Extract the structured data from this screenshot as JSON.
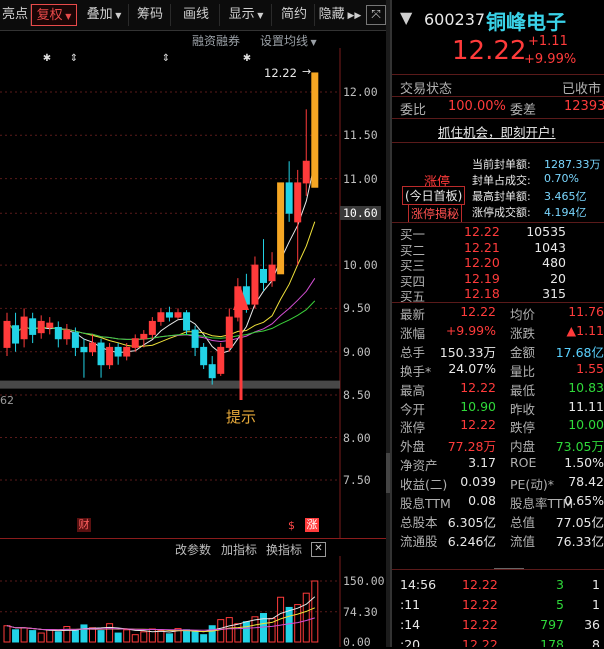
{
  "toolbar": {
    "items": [
      "亮点",
      "复权",
      "叠加",
      "筹码",
      "画线",
      "显示",
      "简约",
      "隐藏"
    ],
    "active_index": 1,
    "close_icon": "resize-icon"
  },
  "subheader": {
    "margin_label": "融资融券",
    "ma_label": "设置均线"
  },
  "main_chart": {
    "price_label": "12.22",
    "y_ticks": [
      "12.00",
      "11.50",
      "11.00",
      "10.60",
      "10.00",
      "9.50",
      "9.00",
      "8.50",
      "8.00",
      "7.50"
    ],
    "highlight_tick": "10.60",
    "low_label": "62",
    "annotation": "提示",
    "badge_fin": "财",
    "badge_zhang": "涨"
  },
  "volume_panel": {
    "buttons": [
      "改参数",
      "加指标",
      "换指标"
    ],
    "y_ticks": [
      "150.00",
      "74.30",
      "0.00"
    ]
  },
  "chart_data": {
    "type": "candlestick",
    "y_axis_ticks": [
      12.0,
      11.5,
      11.0,
      10.6,
      10.0,
      9.5,
      9.0,
      8.5
    ],
    "last_price_label": 12.22,
    "candles": [
      {
        "o": 9.05,
        "c": 9.35,
        "h": 9.45,
        "l": 8.95,
        "up": true
      },
      {
        "o": 9.3,
        "c": 9.1,
        "h": 9.45,
        "l": 9.0,
        "up": false
      },
      {
        "o": 9.15,
        "c": 9.4,
        "h": 9.5,
        "l": 9.05,
        "up": true
      },
      {
        "o": 9.38,
        "c": 9.2,
        "h": 9.45,
        "l": 9.1,
        "up": false
      },
      {
        "o": 9.22,
        "c": 9.35,
        "h": 9.42,
        "l": 9.15,
        "up": true
      },
      {
        "o": 9.33,
        "c": 9.28,
        "h": 9.4,
        "l": 9.2,
        "up": true
      },
      {
        "o": 9.28,
        "c": 9.15,
        "h": 9.35,
        "l": 9.05,
        "up": false
      },
      {
        "o": 9.15,
        "c": 9.25,
        "h": 9.32,
        "l": 9.08,
        "up": true
      },
      {
        "o": 9.22,
        "c": 9.05,
        "h": 9.28,
        "l": 8.95,
        "up": false
      },
      {
        "o": 9.05,
        "c": 9.0,
        "h": 9.15,
        "l": 8.7,
        "up": false
      },
      {
        "o": 9.0,
        "c": 9.1,
        "h": 9.2,
        "l": 8.95,
        "up": true
      },
      {
        "o": 9.1,
        "c": 8.85,
        "h": 9.15,
        "l": 8.7,
        "up": false
      },
      {
        "o": 8.85,
        "c": 9.05,
        "h": 9.1,
        "l": 8.8,
        "up": true
      },
      {
        "o": 9.05,
        "c": 8.95,
        "h": 9.1,
        "l": 8.85,
        "up": false
      },
      {
        "o": 8.95,
        "c": 9.05,
        "h": 9.1,
        "l": 8.9,
        "up": true
      },
      {
        "o": 9.05,
        "c": 9.15,
        "h": 9.2,
        "l": 9.0,
        "up": true
      },
      {
        "o": 9.15,
        "c": 9.2,
        "h": 9.25,
        "l": 9.05,
        "up": true
      },
      {
        "o": 9.2,
        "c": 9.35,
        "h": 9.4,
        "l": 9.15,
        "up": true
      },
      {
        "o": 9.35,
        "c": 9.45,
        "h": 9.5,
        "l": 9.3,
        "up": true
      },
      {
        "o": 9.45,
        "c": 9.4,
        "h": 9.52,
        "l": 9.35,
        "up": false
      },
      {
        "o": 9.4,
        "c": 9.45,
        "h": 9.5,
        "l": 9.38,
        "up": true
      },
      {
        "o": 9.45,
        "c": 9.25,
        "h": 9.48,
        "l": 9.2,
        "up": false
      },
      {
        "o": 9.25,
        "c": 9.05,
        "h": 9.3,
        "l": 8.95,
        "up": false
      },
      {
        "o": 9.05,
        "c": 8.85,
        "h": 9.1,
        "l": 8.8,
        "up": false
      },
      {
        "o": 8.85,
        "c": 8.7,
        "h": 8.95,
        "l": 8.62,
        "up": false
      },
      {
        "o": 8.75,
        "c": 9.05,
        "h": 9.1,
        "l": 8.72,
        "up": true
      },
      {
        "o": 9.05,
        "c": 9.4,
        "h": 9.5,
        "l": 9.0,
        "up": true
      },
      {
        "o": 9.4,
        "c": 9.75,
        "h": 9.85,
        "l": 9.35,
        "up": true
      },
      {
        "o": 9.75,
        "c": 9.55,
        "h": 9.9,
        "l": 9.45,
        "up": false
      },
      {
        "o": 9.55,
        "c": 10.0,
        "h": 10.1,
        "l": 9.5,
        "up": true
      },
      {
        "o": 9.95,
        "c": 9.8,
        "h": 10.3,
        "l": 9.7,
        "up": false
      },
      {
        "o": 9.82,
        "c": 10.0,
        "h": 10.15,
        "l": 9.75,
        "up": true
      },
      {
        "o": 9.9,
        "c": 10.95,
        "h": 10.95,
        "l": 9.9,
        "up": true,
        "limit": true
      },
      {
        "o": 10.95,
        "c": 10.6,
        "h": 11.2,
        "l": 10.5,
        "up": false
      },
      {
        "o": 10.5,
        "c": 10.95,
        "h": 11.1,
        "l": 10.0,
        "up": true
      },
      {
        "o": 10.95,
        "c": 11.2,
        "h": 11.8,
        "l": 10.8,
        "up": true
      },
      {
        "o": 10.9,
        "c": 12.22,
        "h": 12.22,
        "l": 10.9,
        "up": true,
        "limit": true
      }
    ],
    "volume": [
      40,
      30,
      35,
      28,
      22,
      30,
      25,
      38,
      30,
      42,
      35,
      28,
      45,
      22,
      30,
      18,
      25,
      32,
      28,
      20,
      33,
      30,
      25,
      18,
      40,
      55,
      60,
      45,
      50,
      62,
      70,
      58,
      110,
      85,
      92,
      120,
      150
    ],
    "volume_ylim": [
      0,
      150
    ]
  },
  "quote": {
    "code": "600237",
    "name": "铜峰电子",
    "price": "12.22",
    "change": "+1.11",
    "change_pct": "+9.99%",
    "trade_status_label": "交易状态",
    "trade_status": "已收市",
    "wb_label": "委比",
    "wb_value": "100.00%",
    "wc_label": "委差",
    "wc_value": "12393",
    "promo": "抓住机会，即刻开户!",
    "limit_tag": "涨停",
    "limit_sub": "(今日首板)",
    "limit_btn": "涨停揭秘",
    "seal": [
      {
        "k": "当前封单额:",
        "v": "1287.33万"
      },
      {
        "k": "封单占成交:",
        "v": "0.70%"
      },
      {
        "k": "最高封单额:",
        "v": "3.465亿"
      },
      {
        "k": "涨停成交额:",
        "v": "4.194亿"
      }
    ],
    "bids": [
      {
        "k": "买一",
        "p": "12.22",
        "v": "10535"
      },
      {
        "k": "买二",
        "p": "12.21",
        "v": "1043"
      },
      {
        "k": "买三",
        "p": "12.20",
        "v": "480"
      },
      {
        "k": "买四",
        "p": "12.19",
        "v": "20"
      },
      {
        "k": "买五",
        "p": "12.18",
        "v": "315"
      }
    ],
    "stats": [
      {
        "k1": "最新",
        "v1": "12.22",
        "c1": "red",
        "k2": "均价",
        "v2": "11.76",
        "c2": "red"
      },
      {
        "k1": "涨幅",
        "v1": "+9.99%",
        "c1": "red",
        "k2": "涨跌",
        "v2": "▲1.11",
        "c2": "red"
      },
      {
        "k1": "总手",
        "v1": "150.33万",
        "c1": "white",
        "k2": "金额",
        "v2": "17.68亿",
        "c2": "cyan"
      },
      {
        "k1": "换手*",
        "v1": "24.07%",
        "c1": "white",
        "k2": "量比",
        "v2": "1.55",
        "c2": "red"
      },
      {
        "k1": "最高",
        "v1": "12.22",
        "c1": "red",
        "k2": "最低",
        "v2": "10.83",
        "c2": "green"
      },
      {
        "k1": "今开",
        "v1": "10.90",
        "c1": "green",
        "k2": "昨收",
        "v2": "11.11",
        "c2": "white"
      },
      {
        "k1": "涨停",
        "v1": "12.22",
        "c1": "red",
        "k2": "跌停",
        "v2": "10.00",
        "c2": "green"
      },
      {
        "k1": "外盘",
        "v1": "77.28万",
        "c1": "red",
        "k2": "内盘",
        "v2": "73.05万",
        "c2": "green"
      },
      {
        "k1": "净资产",
        "v1": "3.17",
        "c1": "white",
        "k2": "ROE",
        "v2": "1.50%",
        "c2": "white"
      },
      {
        "k1": "收益(二)",
        "v1": "0.039",
        "c1": "white",
        "k2": "PE(动)*",
        "v2": "78.42",
        "c2": "white"
      },
      {
        "k1": "股息TTM",
        "v1": "0.08",
        "c1": "white",
        "k2": "股息率TTM",
        "v2": "0.65%",
        "c2": "white"
      },
      {
        "k1": "总股本",
        "v1": "6.305亿",
        "c1": "white",
        "k2": "总值",
        "v2": "77.05亿",
        "c2": "white"
      },
      {
        "k1": "流通股",
        "v1": "6.246亿",
        "c1": "white",
        "k2": "流值",
        "v2": "76.33亿",
        "c2": "white"
      }
    ],
    "ticks": [
      {
        "t": "14:56",
        "p": "12.22",
        "v": "3",
        "n": "1"
      },
      {
        "t": ":11",
        "p": "12.22",
        "v": "5",
        "n": "1"
      },
      {
        "t": ":14",
        "p": "12.22",
        "v": "797",
        "n": "36"
      },
      {
        "t": ":20",
        "p": "12.22",
        "v": "178",
        "n": "8"
      },
      {
        "t": ":23",
        "p": "12.22",
        "v": "62",
        "n": "6"
      }
    ]
  },
  "colors": {
    "up": "#ff3b3b",
    "down": "#22d3e6",
    "limit": "#f5a623",
    "ma5": "#e8e8e8",
    "ma10": "#f0e23a",
    "ma20": "#d34fd3",
    "ma60": "#3bd13b"
  }
}
